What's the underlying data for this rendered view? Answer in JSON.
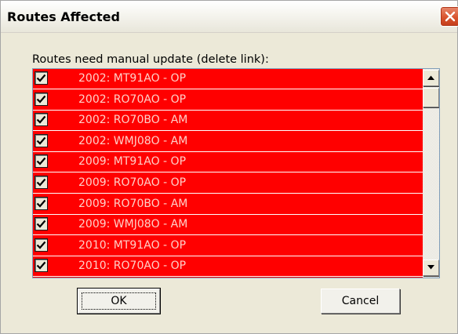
{
  "dialog": {
    "title": "Routes Affected",
    "close_icon": "close-icon",
    "list_label": "Routes need manual update (delete link):",
    "routes": [
      {
        "label": "2002: MT91AO - OP",
        "checked": true
      },
      {
        "label": "2002: RO70AO - OP",
        "checked": true
      },
      {
        "label": "2002: RO70BO - AM",
        "checked": true
      },
      {
        "label": "2002: WMJ08O - AM",
        "checked": true
      },
      {
        "label": "2009: MT91AO - OP",
        "checked": true
      },
      {
        "label": "2009: RO70AO - OP",
        "checked": true
      },
      {
        "label": "2009: RO70BO - AM",
        "checked": true
      },
      {
        "label": "2009: WMJ08O - AM",
        "checked": true
      },
      {
        "label": "2010: MT91AO - OP",
        "checked": true
      },
      {
        "label": "2010: RO70AO - OP",
        "checked": true
      }
    ],
    "ok_label": "OK",
    "cancel_label": "Cancel"
  },
  "colors": {
    "row_background": "#ff0000",
    "row_text": "#ffd0c8",
    "dialog_background": "#ece9d8",
    "close_button": "#d9542f"
  }
}
